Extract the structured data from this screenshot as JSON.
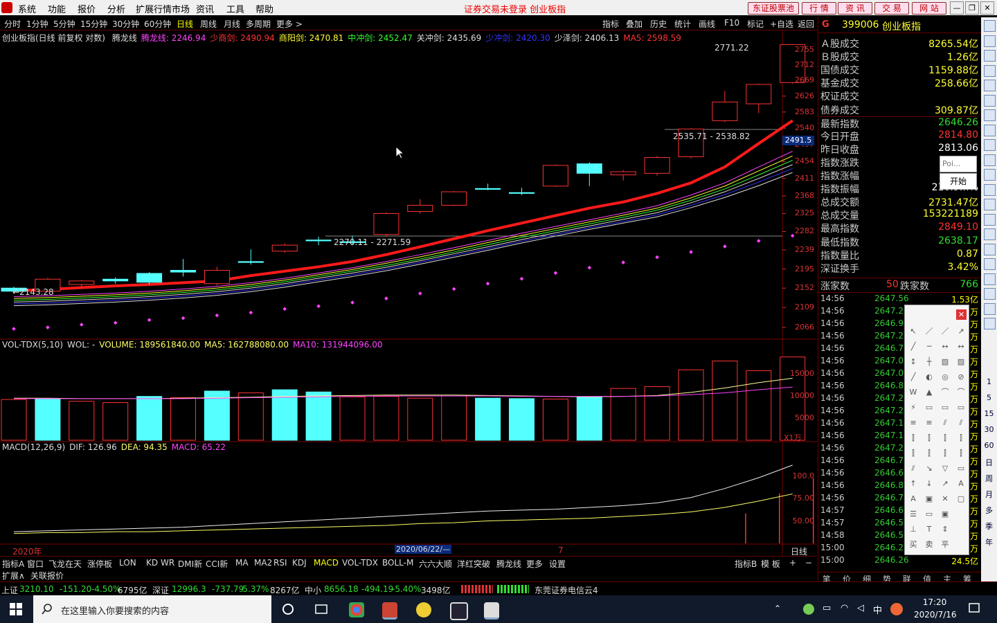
{
  "menu": [
    "系统",
    "功能",
    "报价",
    "分析",
    "扩展行情市场",
    "资讯",
    "工具",
    "帮助"
  ],
  "status_warning": "证券交易未登录 创业板指",
  "top_buttons": [
    "东证股票池",
    "行 情",
    "资 讯",
    "交 易",
    "网 站"
  ],
  "win_buttons": [
    "—",
    "❐",
    "✕"
  ],
  "periods": [
    "分时",
    "1分钟",
    "5分钟",
    "15分钟",
    "30分钟",
    "60分钟",
    "日线",
    "周线",
    "月线",
    "多周期",
    "更多 >"
  ],
  "active_period": "日线",
  "toolbar": [
    "指标",
    "叠加",
    "历史",
    "统计",
    "画线",
    "F10",
    "标记",
    "+自选",
    "返回"
  ],
  "main_legend": {
    "title": "创业板指(日线 前复权 对数)",
    "items": [
      {
        "t": "腾龙线",
        "c": "#dddddd"
      },
      {
        "t": "腾龙线: 2246.94",
        "c": "#ff44ff"
      },
      {
        "t": "少商剑: 2490.94",
        "c": "#ff3333"
      },
      {
        "t": "商阳剑: 2470.81",
        "c": "#ffff33"
      },
      {
        "t": "中冲剑: 2452.47",
        "c": "#33ff33"
      },
      {
        "t": "关冲剑: 2435.69",
        "c": "#dddddd"
      },
      {
        "t": "少冲剑: 2420.30",
        "c": "#3333ff"
      },
      {
        "t": "少泽剑: 2406.13",
        "c": "#dddddd"
      },
      {
        "t": "MA5: 2598.59",
        "c": "#ff3333"
      }
    ]
  },
  "price_axis": [
    "2755",
    "2712",
    "2669",
    "2626",
    "2583",
    "2540",
    "2497",
    "2454",
    "2411",
    "2368",
    "2325",
    "2282",
    "2239",
    "2195",
    "2152",
    "2109",
    "2066"
  ],
  "price_tag": "2491.5",
  "annotations": {
    "high": "2771.22",
    "range1": "2535.71 - 2538.82",
    "range2": "2270.11 - 2271.59",
    "low": "2143.28"
  },
  "vol_legend": {
    "items": [
      {
        "t": "VOL-TDX(5,10)",
        "c": "#dddddd"
      },
      {
        "t": "WOL: -",
        "c": "#dddddd"
      },
      {
        "t": "VOLUME: 189561840.00",
        "c": "#ffff66"
      },
      {
        "t": "MA5: 162788080.00",
        "c": "#ffff66"
      },
      {
        "t": "MA10: 131944096.00",
        "c": "#ff44ff"
      }
    ]
  },
  "vol_axis": [
    "15000",
    "10000",
    "5000"
  ],
  "vol_unit": "X1万",
  "macd_legend": {
    "items": [
      {
        "t": "MACD(12,26,9)",
        "c": "#dddddd"
      },
      {
        "t": "DIF: 126.96",
        "c": "#dddddd"
      },
      {
        "t": "DEA: 94.35",
        "c": "#ffff66"
      },
      {
        "t": "MACD: 65.22",
        "c": "#ff44ff"
      }
    ]
  },
  "macd_axis": [
    "100.0",
    "75.00",
    "50.00"
  ],
  "date_labels": {
    "year": "2020年",
    "date": "2020/06/22/—",
    "tick": "7",
    "period": "日线"
  },
  "indicator_tabs": [
    "指标A",
    "窗口",
    "飞龙在天",
    "涨停板",
    "LON",
    "KD",
    "WR",
    "DMI新",
    "CCI新",
    "MA",
    "MA2",
    "RSI",
    "KDJ",
    "MACD",
    "VOL-TDX",
    "BOLL-M",
    "六六大顺",
    "洋红突破",
    "腾龙线",
    "更多",
    "设置"
  ],
  "active_indicator": "MACD",
  "indicator_right": [
    "指标B",
    "模 板",
    "+",
    "−"
  ],
  "ext_tabs": [
    "扩展∧",
    "关联报价"
  ],
  "right_panel": {
    "code": "399006",
    "name": "创业板指",
    "stats": [
      {
        "k": "Ａ股成交",
        "v": "8265.54亿",
        "c": "#ffff33"
      },
      {
        "k": "Ｂ股成交",
        "v": "1.26亿",
        "c": "#ffff33"
      },
      {
        "k": "国债成交",
        "v": "1159.88亿",
        "c": "#ffff33"
      },
      {
        "k": "基金成交",
        "v": "258.66亿",
        "c": "#ffff33"
      },
      {
        "k": "权证成交",
        "v": "",
        "c": "#ffff33"
      },
      {
        "k": "债券成交",
        "v": "309.87亿",
        "c": "#ffff33"
      },
      {
        "k": "最新指数",
        "v": "2646.26",
        "c": "#33dd33"
      },
      {
        "k": "今日开盘",
        "v": "2814.80",
        "c": "#ff3333"
      },
      {
        "k": "昨日收盘",
        "v": "2813.06",
        "c": "#ffffff"
      },
      {
        "k": "指数涨跌",
        "v": "",
        "c": "#33dd33"
      },
      {
        "k": "指数涨幅",
        "v": "",
        "c": "#33dd33"
      },
      {
        "k": "指数振幅",
        "v": "210.9…%",
        "c": "#ffffff"
      },
      {
        "k": "总成交额",
        "v": "2731.47亿",
        "c": "#ffff33"
      },
      {
        "k": "总成交量",
        "v": "153221189",
        "c": "#ffff33"
      },
      {
        "k": "最高指数",
        "v": "2849.10",
        "c": "#ff3333"
      },
      {
        "k": "最低指数",
        "v": "2638.17",
        "c": "#33dd33"
      },
      {
        "k": "指数量比",
        "v": "0.87",
        "c": "#ffff33"
      },
      {
        "k": "深证换手",
        "v": "3.42%",
        "c": "#ffff33"
      }
    ],
    "up_label": "涨家数",
    "up": "50",
    "down_label": "跌家数",
    "down": "766",
    "ticks": [
      {
        "t": "14:56",
        "p": "2647.56",
        "q": "1.53亿"
      },
      {
        "t": "14:56",
        "p": "2647.2",
        "q": "万"
      },
      {
        "t": "14:56",
        "p": "2646.9",
        "q": "万"
      },
      {
        "t": "14:56",
        "p": "2647.2",
        "q": "万"
      },
      {
        "t": "14:56",
        "p": "2646.7",
        "q": "万"
      },
      {
        "t": "14:56",
        "p": "2647.0",
        "q": "万"
      },
      {
        "t": "14:56",
        "p": "2647.0",
        "q": "万"
      },
      {
        "t": "14:56",
        "p": "2646.8",
        "q": "万"
      },
      {
        "t": "14:56",
        "p": "2647.2",
        "q": "万"
      },
      {
        "t": "14:56",
        "p": "2647.2",
        "q": "万"
      },
      {
        "t": "14:56",
        "p": "2647.1",
        "q": "万"
      },
      {
        "t": "14:56",
        "p": "2647.1",
        "q": "万"
      },
      {
        "t": "14:56",
        "p": "2647.2",
        "q": "万"
      },
      {
        "t": "14:56",
        "p": "2646.7",
        "q": "万"
      },
      {
        "t": "14:56",
        "p": "2646.6",
        "q": "万"
      },
      {
        "t": "14:56",
        "p": "2646.8",
        "q": "万"
      },
      {
        "t": "14:56",
        "p": "2646.7",
        "q": "万"
      },
      {
        "t": "14:57",
        "p": "2646.6",
        "q": "万"
      },
      {
        "t": "14:57",
        "p": "2646.5",
        "q": "万"
      },
      {
        "t": "14:58",
        "p": "2646.5",
        "q": "万"
      },
      {
        "t": "15:00",
        "p": "2646.2",
        "q": "万"
      },
      {
        "t": "15:00",
        "p": "2646.26",
        "q": "24.5亿"
      }
    ],
    "tabs": [
      "笔",
      "价",
      "细",
      "势",
      "联",
      "值",
      "主",
      "筹"
    ]
  },
  "poi_placeholder": "Poi...",
  "start_label": "开始",
  "side_texts": [
    "1",
    "5",
    "15",
    "30",
    "60",
    "日",
    "周",
    "月",
    "多",
    "季",
    "年"
  ],
  "ticker": {
    "sh": {
      "name": "上证",
      "val": "3210.10",
      "chg": "-151.20",
      "pct": "-4.50%",
      "amt": "6795亿"
    },
    "sz": {
      "name": "深证",
      "val": "12996.3",
      "chg": "-737.79",
      "pct": "-5.37%",
      "amt": "8267亿"
    },
    "zx": {
      "name": "中小",
      "val": "8656.18",
      "chg": "-494.19",
      "pct": "-5.40%",
      "amt": "3498亿"
    },
    "broker": "东莞证券电信云4"
  },
  "taskbar": {
    "search_placeholder": "在这里输入你要搜索的内容",
    "time": "17:20",
    "date": "2020/7/16",
    "ime": "中"
  },
  "chart_data": {
    "type": "candlestick",
    "title": "创业板指(日线 前复权 对数)",
    "ylim": [
      2066,
      2755
    ],
    "candles": [
      {
        "o": 2152,
        "c": 2145,
        "h": 2155,
        "l": 2140
      },
      {
        "o": 2145,
        "c": 2172,
        "h": 2175,
        "l": 2143
      },
      {
        "o": 2160,
        "c": 2168,
        "h": 2170,
        "l": 2150
      },
      {
        "o": 2172,
        "c": 2168,
        "h": 2176,
        "l": 2162
      },
      {
        "o": 2185,
        "c": 2165,
        "h": 2188,
        "l": 2160
      },
      {
        "o": 2192,
        "c": 2188,
        "h": 2218,
        "l": 2178
      },
      {
        "o": 2162,
        "c": 2192,
        "h": 2200,
        "l": 2158
      },
      {
        "o": 2212,
        "c": 2210,
        "h": 2240,
        "l": 2205
      },
      {
        "o": 2236,
        "c": 2250,
        "h": 2254,
        "l": 2232
      },
      {
        "o": 2262,
        "c": 2260,
        "h": 2270,
        "l": 2250
      },
      {
        "o": 2258,
        "c": 2256,
        "h": 2272,
        "l": 2250
      },
      {
        "o": 2275,
        "c": 2325,
        "h": 2328,
        "l": 2270
      },
      {
        "o": 2330,
        "c": 2345,
        "h": 2360,
        "l": 2325
      },
      {
        "o": 2345,
        "c": 2378,
        "h": 2380,
        "l": 2343
      },
      {
        "o": 2386,
        "c": 2384,
        "h": 2398,
        "l": 2382
      },
      {
        "o": 2376,
        "c": 2374,
        "h": 2388,
        "l": 2370
      },
      {
        "o": 2392,
        "c": 2444,
        "h": 2446,
        "l": 2390
      },
      {
        "o": 2448,
        "c": 2424,
        "h": 2452,
        "l": 2392
      },
      {
        "o": 2420,
        "c": 2428,
        "h": 2432,
        "l": 2406
      },
      {
        "o": 2424,
        "c": 2464,
        "h": 2468,
        "l": 2418
      },
      {
        "o": 2466,
        "c": 2538,
        "h": 2540,
        "l": 2462
      },
      {
        "o": 2560,
        "c": 2610,
        "h": 2640,
        "l": 2556
      },
      {
        "o": 2605,
        "c": 2658,
        "h": 2660,
        "l": 2580
      },
      {
        "o": 2663,
        "c": 2770,
        "h": 2771,
        "l": 2660
      }
    ],
    "ma_red": [
      2146,
      2149,
      2153,
      2157,
      2160,
      2164,
      2168,
      2180,
      2190,
      2200,
      2212,
      2228,
      2246,
      2265,
      2284,
      2302,
      2320,
      2338,
      2353,
      2374,
      2400,
      2440,
      2500,
      2560
    ],
    "ma_lines": [
      {
        "color": "#ff44ff",
        "values": [
          2133,
          2135,
          2138,
          2141,
          2145,
          2150,
          2156,
          2164,
          2174,
          2186,
          2198,
          2212,
          2228,
          2244,
          2261,
          2278,
          2294,
          2310,
          2326,
          2344,
          2370,
          2400,
          2440,
          2480
        ]
      },
      {
        "color": "#ffff33",
        "values": [
          2129,
          2131,
          2134,
          2137,
          2141,
          2146,
          2152,
          2160,
          2170,
          2182,
          2194,
          2208,
          2223,
          2239,
          2256,
          2273,
          2289,
          2305,
          2321,
          2338,
          2363,
          2392,
          2430,
          2468
        ]
      },
      {
        "color": "#33ff33",
        "values": [
          2125,
          2127,
          2130,
          2133,
          2137,
          2142,
          2148,
          2156,
          2166,
          2178,
          2190,
          2203,
          2218,
          2234,
          2251,
          2268,
          2284,
          2300,
          2316,
          2333,
          2357,
          2385,
          2420,
          2457
        ]
      },
      {
        "color": "#dddddd",
        "values": [
          2121,
          2123,
          2126,
          2129,
          2133,
          2138,
          2144,
          2152,
          2162,
          2174,
          2186,
          2199,
          2214,
          2230,
          2246,
          2263,
          2279,
          2295,
          2311,
          2327,
          2351,
          2378,
          2411,
          2446
        ]
      },
      {
        "color": "#3333ff",
        "values": [
          2117,
          2119,
          2122,
          2125,
          2129,
          2134,
          2140,
          2148,
          2158,
          2170,
          2182,
          2195,
          2210,
          2226,
          2242,
          2259,
          2275,
          2291,
          2306,
          2322,
          2345,
          2371,
          2402,
          2436
        ]
      },
      {
        "color": "#dddddd",
        "values": [
          2113,
          2115,
          2118,
          2121,
          2125,
          2130,
          2136,
          2144,
          2154,
          2166,
          2178,
          2191,
          2206,
          2222,
          2238,
          2255,
          2271,
          2287,
          2302,
          2317,
          2339,
          2364,
          2393,
          2426
        ]
      }
    ],
    "dots": [
      2063,
      2066,
      2072,
      2076,
      2082,
      2086,
      2092,
      2098,
      2106,
      2112,
      2120,
      2129,
      2140,
      2150,
      2162,
      2173,
      2186,
      2198,
      2210,
      2222,
      2234,
      2247,
      2260,
      2272
    ],
    "volume": [
      9200,
      9400,
      8800,
      8500,
      9900,
      9600,
      11100,
      10700,
      11400,
      10900,
      9800,
      9900,
      9500,
      10000,
      9500,
      9400,
      9300,
      9800,
      11700,
      12100,
      15900,
      17900,
      15700,
      18800
    ],
    "volume_up": [
      false,
      true,
      false,
      false,
      true,
      false,
      true,
      false,
      true,
      true,
      false,
      false,
      false,
      false,
      true,
      true,
      false,
      true,
      false,
      false,
      false,
      false,
      false,
      false
    ],
    "vol_ma5": [
      9500,
      9500,
      9400,
      9400,
      9400,
      9500,
      9600,
      9700,
      9900,
      10000,
      10100,
      10200,
      10200,
      10200,
      10100,
      10000,
      9900,
      9800,
      9900,
      10100,
      10800,
      11800,
      13000,
      14000
    ],
    "vol_ma10": [
      9400,
      9400,
      9400,
      9400,
      9400,
      9400,
      9500,
      9600,
      9700,
      9800,
      9900,
      10000,
      10000,
      10000,
      10000,
      9900,
      9900,
      9900,
      9900,
      10000,
      10300,
      10700,
      11400,
      12000
    ],
    "vol_ylim": [
      0,
      20000
    ],
    "dif": [
      38,
      39,
      40,
      41,
      42,
      43,
      45,
      47,
      49,
      51,
      53,
      55,
      57,
      59,
      61,
      62,
      63,
      65,
      67,
      70,
      76,
      86,
      98,
      112
    ],
    "dea": [
      36,
      37,
      37,
      38,
      38,
      39,
      40,
      41,
      42,
      43,
      44,
      45,
      47,
      48,
      50,
      51,
      52,
      53,
      55,
      57,
      60,
      65,
      72,
      80
    ],
    "macd_bar": [
      0,
      0,
      0,
      0,
      0,
      0,
      0,
      0,
      0,
      0,
      0,
      0,
      0,
      0,
      0,
      0,
      0,
      0,
      0,
      0,
      0,
      30,
      50,
      65
    ],
    "macd_ylim": [
      25,
      125
    ]
  }
}
